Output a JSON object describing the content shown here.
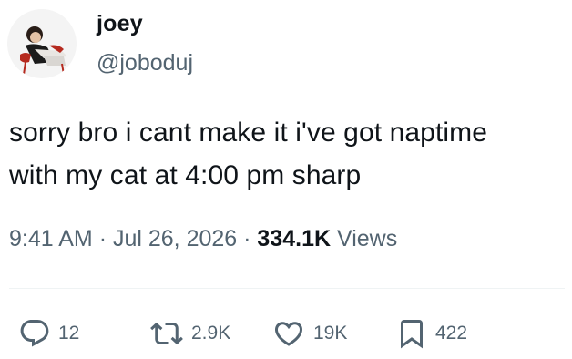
{
  "author": {
    "display_name": "joey",
    "handle": "@joboduj",
    "avatar_icon": "user-avatar-photo"
  },
  "tweet": {
    "lines": [
      "sorry bro i cant make it i've got naptime",
      "with my cat at 4:00 pm sharp"
    ],
    "time": "9:41 AM",
    "separator": "·",
    "date": "Jul 26, 2026",
    "views_count": "334.1K",
    "views_label": "Views"
  },
  "actions": {
    "replies": {
      "icon": "reply-icon",
      "count": "12"
    },
    "reposts": {
      "icon": "repost-icon",
      "count": "2.9K"
    },
    "likes": {
      "icon": "like-icon",
      "count": "19K"
    },
    "bookmarks": {
      "icon": "bookmark-icon",
      "count": "422"
    }
  },
  "colors": {
    "text_primary": "#0f1419",
    "text_secondary": "#536471",
    "divider": "#eff3f4"
  }
}
